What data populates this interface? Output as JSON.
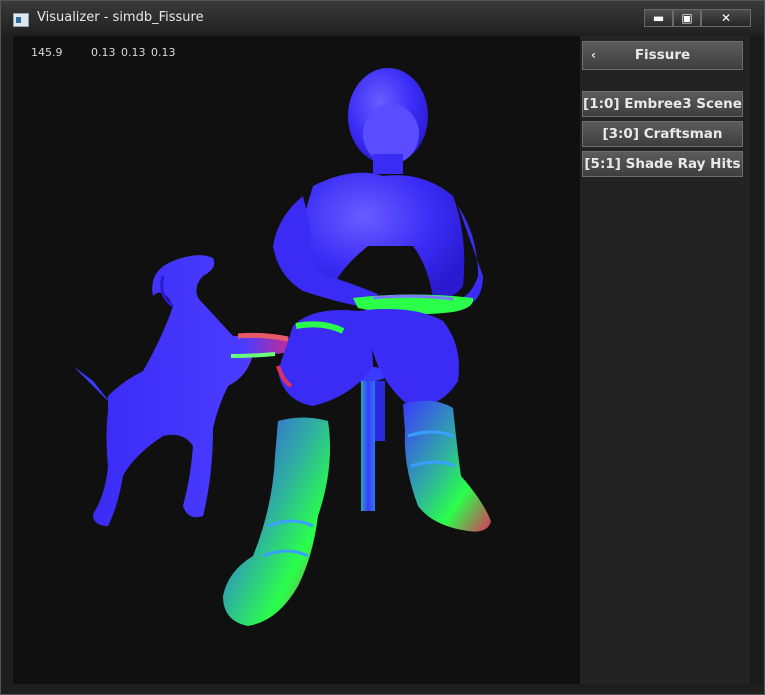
{
  "window": {
    "title": "Visualizer - simdb_Fissure",
    "controls": {
      "minimize": "▬",
      "maximize": "▣",
      "close": "✕"
    }
  },
  "viewport": {
    "stats": [
      "145.9",
      "0.13",
      "0.13",
      "0.13"
    ],
    "scene": "normal-shaded render of a seated craftsman with a dog"
  },
  "panel": {
    "header": {
      "label": "Fissure",
      "back_icon": "chevron-left-icon"
    },
    "items": [
      {
        "label": "[1:0] Embree3 Scene"
      },
      {
        "label": "[3:0] Craftsman"
      },
      {
        "label": "[5:1] Shade Ray Hits"
      }
    ]
  },
  "colors": {
    "viewport_bg": "#101010",
    "panel_bg": "#232323",
    "button_bg": "#4d4d4d",
    "normal_x": "#ff2a2a",
    "normal_y": "#2aff4a",
    "normal_z": "#3a3aff"
  }
}
